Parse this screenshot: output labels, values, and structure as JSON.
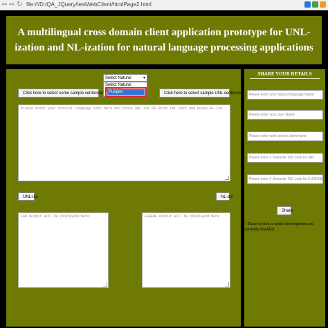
{
  "browser": {
    "back": "⇦",
    "forward": "⇨",
    "reload": "↻",
    "url": "file:///D:/QA_JQuery/testWebClient/htmlPage2.html",
    "ext_colors": [
      "#2d74e0",
      "#4a9e3c",
      "#e8a020"
    ]
  },
  "header": {
    "title": "A multilingual cross domain client application prototype for UNL-ization and NL-ization for natural language processing applications"
  },
  "main": {
    "language_select": {
      "value": "Select Natural language",
      "arrow": "▾"
    },
    "dropdown_options": [
      "Select Natural language",
      "Punjabi"
    ],
    "sample_sentences_button": "Click here to select some sample sentences",
    "sample_unl_button": "Click here to select sample UNL sentences",
    "input_placeholder": "Please enter your natural language text here and press UNL-ize OR enter UNL text and press NL-ize",
    "unlize_button": "UNL-ize",
    "nlize_button": "NL-ize",
    "ian_output_placeholder": "IAN Output will be displayed here",
    "eugene_output_placeholder": "EUGENE Output will be displayed here"
  },
  "sidebar": {
    "title": "SHARE YOUR DETAILS",
    "fields": [
      "Please enter your Natural language Name",
      "Please enter your User Name",
      "Please enter web service client name",
      "Please enter 3 character ISO code for IAN",
      "Please enter 3 character ISO code for EUGENE"
    ],
    "share_button": "Share",
    "note_star": "*",
    "note": "Share section is under development and currently disabled"
  },
  "colors": {
    "panel": "#6f7a05",
    "background": "#000000",
    "highlight": "#e02020",
    "selection": "#3372d6"
  }
}
